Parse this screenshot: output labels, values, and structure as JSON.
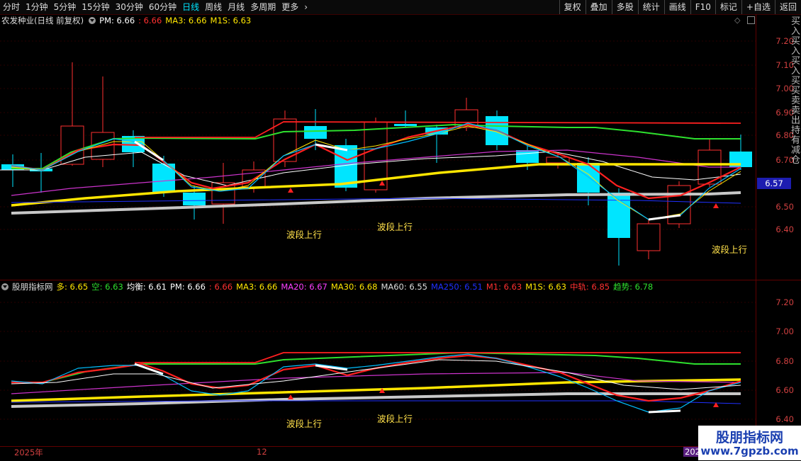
{
  "toolbar": {
    "tabs": [
      "分时",
      "1分钟",
      "5分钟",
      "15分钟",
      "30分钟",
      "60分钟",
      "日线",
      "周线",
      "月线",
      "多周期",
      "更多"
    ],
    "active_tab": "日线",
    "buttons": [
      "复权",
      "叠加",
      "多股",
      "统计",
      "画线",
      "F10",
      "标记",
      "+自选",
      "返回"
    ]
  },
  "main_panel": {
    "title": "农发种业(日线 前复权)",
    "indicators": [
      {
        "label": "PM: 6.66",
        "color": "#ffffff"
      },
      {
        "label": ": 6.66",
        "color": "#ff3030"
      },
      {
        "label": "MA3: 6.66",
        "color": "#ffe600"
      },
      {
        "label": "M1S: 6.63",
        "color": "#ffe600"
      }
    ],
    "y_axis": [
      "7.20",
      "7.10",
      "7.00",
      "6.90",
      "6.80",
      "6.70",
      "6.57",
      "6.50",
      "6.40"
    ],
    "current_price": "6.57",
    "annotations": [
      "波段上行",
      "波段上行",
      "波段上行"
    ]
  },
  "sub_panel": {
    "title": "股朋指标网",
    "indicators": [
      {
        "label": "多: 6.65",
        "color": "#ffe600"
      },
      {
        "label": "空: 6.63",
        "color": "#2ee02e"
      },
      {
        "label": "均衡: 6.61",
        "color": "#ffffff"
      },
      {
        "label": "PM: 6.66",
        "color": "#ffffff"
      },
      {
        "label": ": 6.66",
        "color": "#ff3030"
      },
      {
        "label": "MA3: 6.66",
        "color": "#ffe600"
      },
      {
        "label": "MA20: 6.67",
        "color": "#ff40ff"
      },
      {
        "label": "MA30: 6.68",
        "color": "#ffe600"
      },
      {
        "label": "MA60: 6.55",
        "color": "#dddddd"
      },
      {
        "label": "MA250: 6.51",
        "color": "#2030ff"
      },
      {
        "label": "M1: 6.63",
        "color": "#ff3030"
      },
      {
        "label": "M1S: 6.63",
        "color": "#ffe600"
      },
      {
        "label": "中轨: 6.85",
        "color": "#ff3030"
      },
      {
        "label": "趋势: 6.78",
        "color": "#2ee02e"
      }
    ],
    "y_axis": [
      "7.20",
      "7.00",
      "6.80",
      "6.60",
      "6.40"
    ],
    "annotations": [
      "波段上行",
      "波段上行"
    ]
  },
  "side_text": "买入买入买入买买卖卖出持有减仓",
  "dates": [
    "2025年",
    "12",
    "202"
  ],
  "watermark": {
    "line1": "股朋指标网",
    "line2": "www.7gpzb.com"
  },
  "colors": {
    "up": "#ff3030",
    "down": "#00e5ff",
    "ma_green": "#2ee02e",
    "ma_yellow": "#ffe600",
    "ma_gray": "#c8c8c8"
  }
}
